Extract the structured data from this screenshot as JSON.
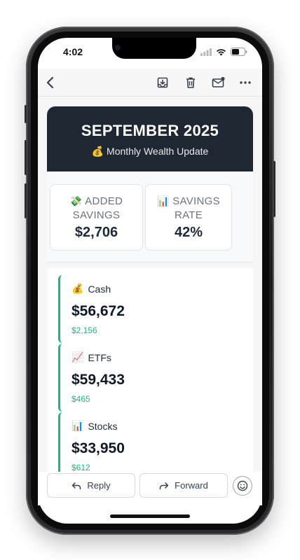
{
  "status_bar": {
    "time": "4:02"
  },
  "toolbar": {
    "back_icon": "chevron-left-icon",
    "archive_icon": "archive-icon",
    "delete_icon": "trash-icon",
    "mark_unread_icon": "mail-unread-icon",
    "more_icon": "more-horizontal-icon"
  },
  "hero": {
    "title": "SEPTEMBER 2025",
    "subtitle_emoji": "💰",
    "subtitle": "Monthly Wealth Update",
    "background_color": "#1f2733"
  },
  "stats": [
    {
      "emoji": "💸",
      "label_line1": "ADDED",
      "label_line2": "SAVINGS",
      "value": "$2,706"
    },
    {
      "emoji": "📊",
      "label_line1": "SAVINGS",
      "label_line2": "RATE",
      "value": "42%"
    }
  ],
  "accounts": [
    {
      "emoji": "💰",
      "name": "Cash",
      "value": "$56,672",
      "change": "$2,156"
    },
    {
      "emoji": "📈",
      "name": "ETFs",
      "value": "$59,433",
      "change": "$465"
    },
    {
      "emoji": "📊",
      "name": "Stocks",
      "value": "$33,950",
      "change": "$612"
    }
  ],
  "actions": {
    "reply_label": "Reply",
    "forward_label": "Forward",
    "emoji_icon": "smiley-icon"
  },
  "colors": {
    "accent_green": "#1fb57f",
    "text_dark": "#1f2937"
  }
}
